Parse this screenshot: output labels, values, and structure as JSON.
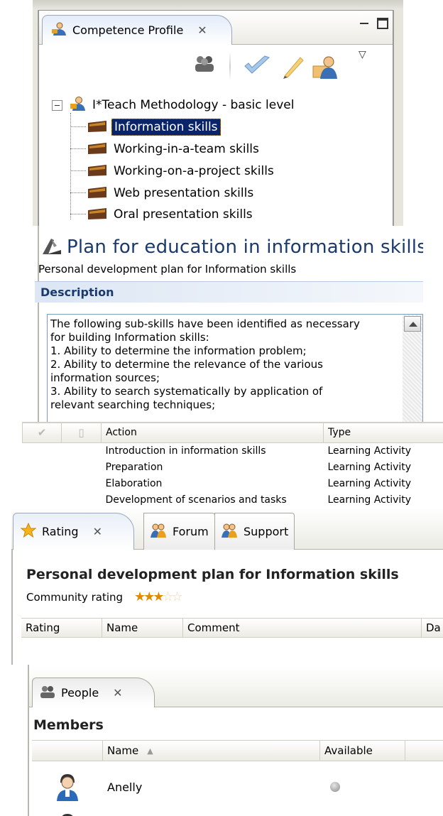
{
  "competence_profile": {
    "tab_label": "Competence Profile",
    "root": {
      "label": "I*Teach Methodology - basic level",
      "expanded": true
    },
    "skills": [
      {
        "label": "Information skills",
        "selected": true
      },
      {
        "label": "Working-in-a-team skills",
        "selected": false
      },
      {
        "label": "Working-on-a-project skills",
        "selected": false
      },
      {
        "label": "Web presentation skills",
        "selected": false
      },
      {
        "label": "Oral presentation skills",
        "selected": false
      }
    ]
  },
  "plan": {
    "title": "Plan for education in information skills",
    "subtitle": "Personal development plan for Information skills",
    "section_label": "Description",
    "description_lines": [
      "The following sub-skills have been identified as necessary",
      "for building Information skills:",
      "1.  Ability to determine the information problem;",
      "2.  Ability to determine the relevance of the various",
      "information sources;",
      "3.  Ability to search systematically by application of",
      "relevant searching techniques;"
    ]
  },
  "actions_table": {
    "columns": [
      "Action",
      "Type"
    ],
    "rows": [
      {
        "action": "Introduction in information skills",
        "type": "Learning Activity"
      },
      {
        "action": "Preparation",
        "type": "Learning Activity"
      },
      {
        "action": "Elaboration",
        "type": "Learning Activity"
      },
      {
        "action": "Development of scenarios and tasks",
        "type": "Learning Activity"
      }
    ]
  },
  "rating": {
    "tabs": {
      "rating": "Rating",
      "forum": "Forum",
      "support": "Support"
    },
    "title": "Personal development plan for Information skills",
    "community_label": "Community rating",
    "community_value": 2.5,
    "community_max": 5,
    "columns": {
      "rating": "Rating",
      "name": "Name",
      "comment": "Comment",
      "date": "Da"
    }
  },
  "people": {
    "tab_label": "People",
    "section_title": "Members",
    "columns": {
      "name": "Name",
      "available": "Available"
    },
    "members": [
      {
        "name": "Anelly",
        "available": false
      },
      {
        "name": "",
        "available": false
      }
    ]
  },
  "colors": {
    "selection": "#0a246a",
    "title_blue": "#1a3a6e",
    "star": "#e08a00"
  }
}
